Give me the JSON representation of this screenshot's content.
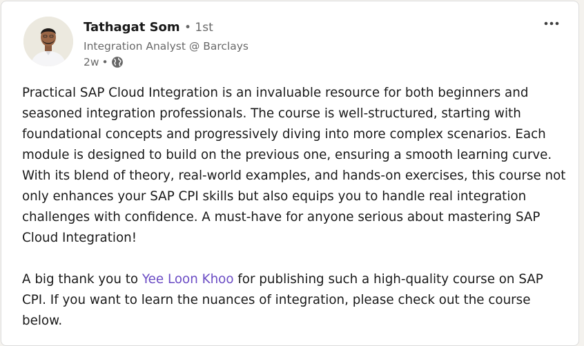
{
  "post": {
    "author": {
      "name": "Tathagat Som",
      "connection": "1st",
      "headline": "Integration Analyst @ Barclays",
      "time": "2w",
      "visibility_icon": "globe-icon"
    },
    "menu_icon": "more-horizontal-icon",
    "paragraph1": "Practical SAP Cloud Integration is an invaluable resource for both beginners and seasoned integration professionals. The course is well-structured, starting with foundational concepts and progressively diving into more complex scenarios. Each module is designed to build on the previous one, ensuring a smooth learning curve. With its blend of theory, real-world examples, and hands-on exercises, this course not only enhances your SAP CPI skills but also equips you to handle real integration challenges with confidence. A must-have for anyone serious about mastering SAP Cloud Integration!",
    "paragraph2_before": "A big thank you to ",
    "mention": "Yee Loon Khoo",
    "paragraph2_after": " for publishing such a high-quality course on SAP CPI. If you want to learn the nuances of integration, please check out the course below.",
    "mention_color": "#6a4bc4"
  }
}
